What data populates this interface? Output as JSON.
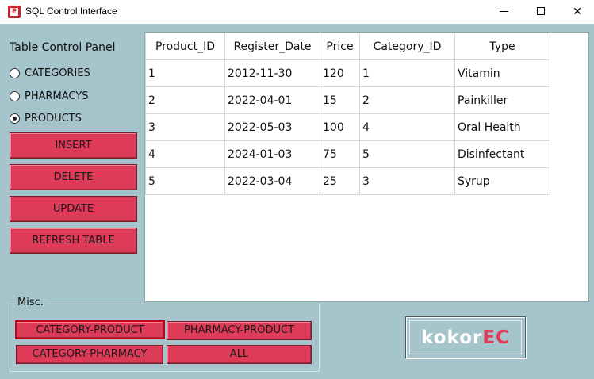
{
  "window": {
    "title": "SQL Control Interface",
    "icon_letter": "E",
    "minimize": "",
    "maximize": "",
    "close": "✕"
  },
  "panel": {
    "title": "Table Control Panel",
    "radios": [
      {
        "label": "CATEGORIES",
        "checked": false
      },
      {
        "label": "PHARMACYS",
        "checked": false
      },
      {
        "label": "PRODUCTS",
        "checked": true
      }
    ],
    "buttons": {
      "insert": "INSERT",
      "delete": "DELETE",
      "update": "UPDATE",
      "refresh": "REFRESH TABLE"
    }
  },
  "table": {
    "headers": [
      "Product_ID",
      "Register_Date",
      "Price",
      "Category_ID",
      "Type"
    ],
    "rows": [
      [
        "1",
        "2012-11-30",
        "120",
        "1",
        "Vitamin"
      ],
      [
        "2",
        "2022-04-01",
        "15",
        "2",
        "Painkiller"
      ],
      [
        "3",
        "2022-05-03",
        "100",
        "4",
        "Oral Health"
      ],
      [
        "4",
        "2024-01-03",
        "75",
        "5",
        "Disinfectant"
      ],
      [
        "5",
        "2022-03-04",
        "25",
        "3",
        "Syrup"
      ]
    ]
  },
  "misc": {
    "label": "Misc.",
    "category_product": "CATEGORY-PRODUCT",
    "pharmacy_product": "PHARMACY-PRODUCT",
    "category_pharmacy": "CATEGORY-PHARMACY",
    "all": "ALL"
  },
  "logo": {
    "text_a": "kokor",
    "text_b": "EC"
  },
  "colors": {
    "background": "#a6c4cc",
    "button": "#dd3b58",
    "focus_border": "#c4001a"
  }
}
